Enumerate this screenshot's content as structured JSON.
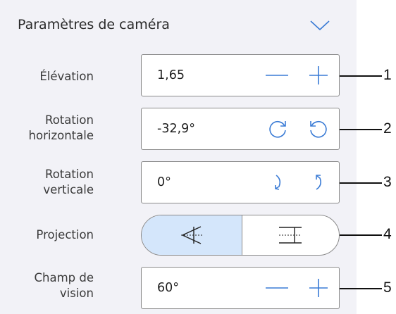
{
  "panel": {
    "title": "Paramètres de caméra",
    "rows": [
      {
        "label_l1": "Élévation",
        "label_l2": "",
        "value": "1,65",
        "callout": "1"
      },
      {
        "label_l1": "Rotation",
        "label_l2": "horizontale",
        "value": "-32,9°",
        "callout": "2"
      },
      {
        "label_l1": "Rotation",
        "label_l2": "verticale",
        "value": "0°",
        "callout": "3"
      },
      {
        "label_l1": "Projection",
        "label_l2": "",
        "callout": "4"
      },
      {
        "label_l1": "Champ de",
        "label_l2": "vision",
        "value": "60°",
        "callout": "5"
      }
    ]
  },
  "colors": {
    "panel_bg": "#f2f2f7",
    "selected_segment": "#d4e6fb",
    "border": "#8a8a8a"
  },
  "icons": {
    "collapse": "chevron-down-icon",
    "decrement": "minus-icon",
    "increment": "plus-icon",
    "rotate_clockwise": "rotate-clockwise-icon",
    "rotate_counterclockwise": "rotate-counterclockwise-icon",
    "tilt_down": "tilt-down-icon",
    "tilt_up": "tilt-up-icon",
    "perspective": "perspective-projection-icon",
    "orthographic": "orthographic-projection-icon"
  }
}
